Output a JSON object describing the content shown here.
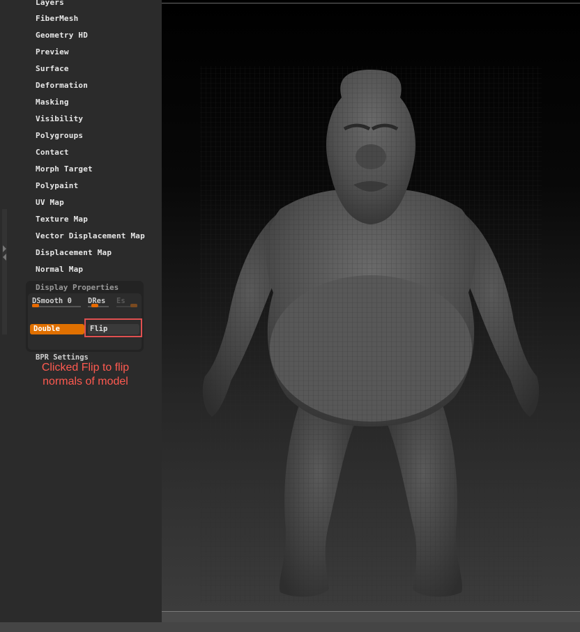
{
  "sidebar": {
    "items": [
      "Layers",
      "FiberMesh",
      "Geometry HD",
      "Preview",
      "Surface",
      "Deformation",
      "Masking",
      "Visibility",
      "Polygroups",
      "Contact",
      "Morph Target",
      "Polypaint",
      "UV Map",
      "Texture Map",
      "Vector Displacement Map",
      "Displacement Map",
      "Normal Map"
    ]
  },
  "display_properties": {
    "header": "Display Properties",
    "dsmooth_label": "DSmooth",
    "dsmooth_value": "0",
    "dres_label": "DRes",
    "es_label": "Es",
    "double_label": "Double",
    "flip_label": "Flip",
    "bpr_label": "BPR Settings"
  },
  "annotation": {
    "line1": "Clicked Flip to flip",
    "line2": "normals of model"
  },
  "colors": {
    "accent": "#e07000",
    "annotation": "#ff5a50",
    "panel_bg": "#2b2b2b"
  },
  "viewport": {
    "content": "sculpted-character-model"
  }
}
